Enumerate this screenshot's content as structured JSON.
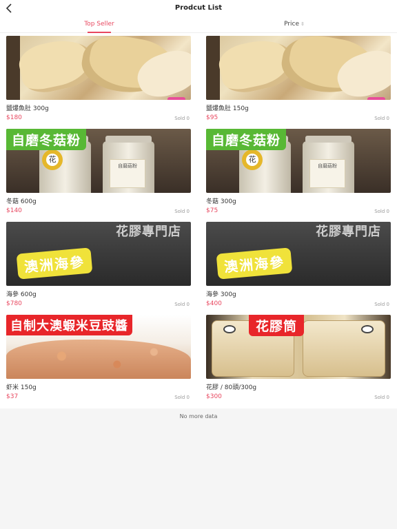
{
  "header": {
    "title": "Prodcut List"
  },
  "tabs": [
    {
      "label": "Top Seller",
      "active": true
    },
    {
      "label": "Price",
      "sort_icon": "sort-updown-icon"
    }
  ],
  "products": [
    {
      "name": "鹽爆魚肚 300g",
      "price": "$180",
      "sold": "Sold 0",
      "image": "fish-maw-chips"
    },
    {
      "name": "鹽爆魚肚 150g",
      "price": "$95",
      "sold": "Sold 0",
      "image": "fish-maw-chips"
    },
    {
      "name": "冬菇 600g",
      "price": "$140",
      "sold": "Sold 0",
      "image": "mushroom-powder-jars",
      "image_tag": "自磨冬菇粉",
      "jar_seal": "花",
      "jar_label": "自磨菇粉"
    },
    {
      "name": "冬菇 300g",
      "price": "$75",
      "sold": "Sold 0",
      "image": "mushroom-powder-jars",
      "image_tag": "自磨冬菇粉",
      "jar_seal": "花",
      "jar_label": "自磨菇粉"
    },
    {
      "name": "海參 600g",
      "price": "$780",
      "sold": "Sold 0",
      "image": "sea-cucumber",
      "image_tag": "澳洲海參",
      "shop_sign": "花膠專門店"
    },
    {
      "name": "海參 300g",
      "price": "$400",
      "sold": "Sold 0",
      "image": "sea-cucumber",
      "image_tag": "澳洲海參",
      "shop_sign": "花膠專門店"
    },
    {
      "name": "虾米 150g",
      "price": "$37",
      "sold": "Sold 0",
      "image": "dried-shrimp",
      "image_tag": "自制大澳蝦米豆豉醬"
    },
    {
      "name": "花膠 / 80頭/300g",
      "price": "$300",
      "sold": "Sold 0",
      "image": "fish-maw-bags",
      "image_tag": "花膠筒"
    }
  ],
  "footer": {
    "no_more": "No more data"
  },
  "colors": {
    "accent": "#e8475f",
    "muted": "#999999"
  }
}
